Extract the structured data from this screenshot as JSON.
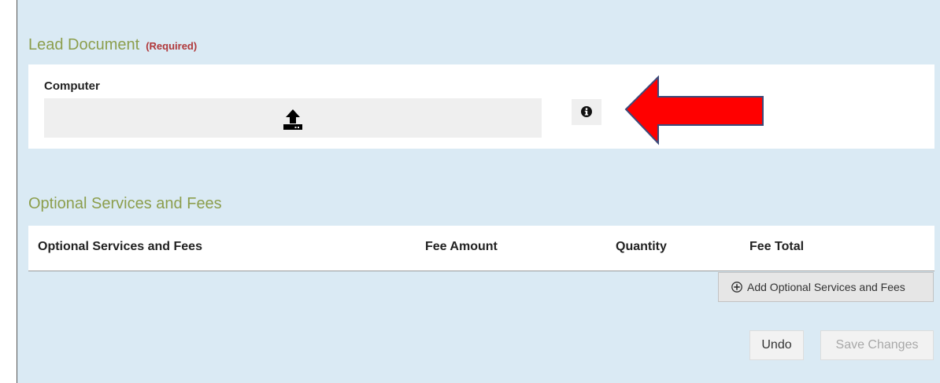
{
  "lead_document": {
    "title": "Lead Document",
    "required_label": "(Required)",
    "source_label": "Computer",
    "upload_icon": "upload-icon",
    "info_icon": "info-icon"
  },
  "optional_services": {
    "title": "Optional Services and Fees",
    "columns": [
      "Optional Services and Fees",
      "Fee Amount",
      "Quantity",
      "Fee Total"
    ],
    "add_button_label": "Add Optional Services and Fees",
    "add_button_icon": "plus-circle-icon"
  },
  "actions": {
    "undo_label": "Undo",
    "save_label": "Save Changes"
  },
  "colors": {
    "panel_background": "#daeaf4",
    "section_title": "#8c9e4d",
    "required": "#b0383a",
    "arrow": "#ff0000"
  }
}
